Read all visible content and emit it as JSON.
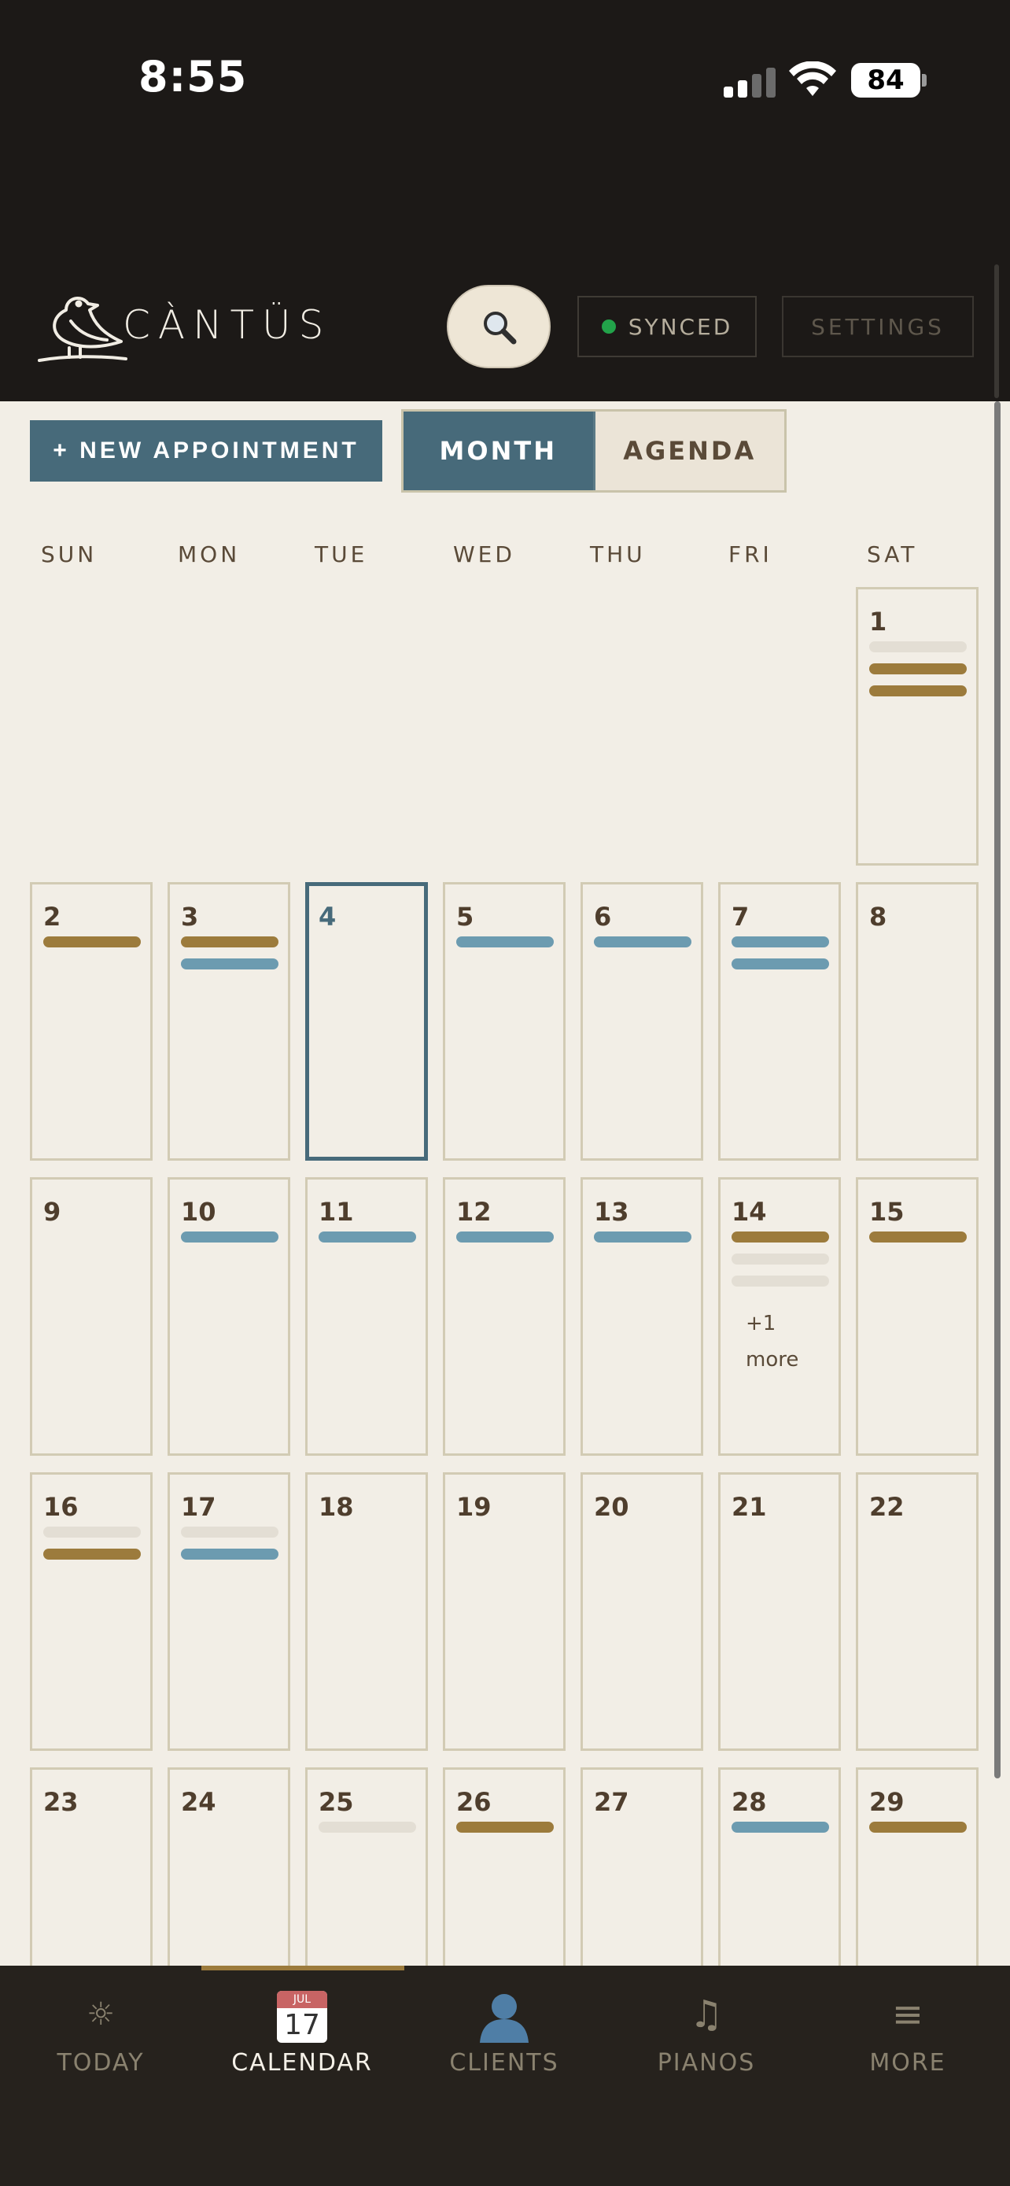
{
  "status_bar": {
    "time": "8:55",
    "battery": "84",
    "icons": [
      "cellular-signal-icon",
      "wifi-icon",
      "battery-icon"
    ]
  },
  "header": {
    "brand": "CÀNTÜS",
    "logo_icon": "bird-logo-icon",
    "search_icon": "magnifier-icon",
    "sync_label": "SYNCED",
    "sync_color": "#22a34a",
    "settings_label": "SETTINGS"
  },
  "toolbar": {
    "new_appointment_label": "+ NEW APPOINTMENT",
    "view_month_label": "MONTH",
    "view_agenda_label": "AGENDA",
    "active_view": "MONTH"
  },
  "calendar": {
    "weekdays": [
      "SUN",
      "MON",
      "TUE",
      "WED",
      "THU",
      "FRI",
      "SAT"
    ],
    "today": "4",
    "more_label": "+1 more",
    "colors": {
      "gold": "#9c7b3c",
      "blue": "#6c9bb0",
      "gray": "#e3ded4",
      "accent": "#476a7a"
    },
    "weeks": [
      [
        null,
        null,
        null,
        null,
        null,
        null,
        {
          "day": "1",
          "events": [
            "gray",
            "gold",
            "gold"
          ]
        }
      ],
      [
        {
          "day": "2",
          "events": [
            "gold"
          ]
        },
        {
          "day": "3",
          "events": [
            "gold",
            "blue"
          ]
        },
        {
          "day": "4",
          "events": []
        },
        {
          "day": "5",
          "events": [
            "blue"
          ]
        },
        {
          "day": "6",
          "events": [
            "blue"
          ]
        },
        {
          "day": "7",
          "events": [
            "blue",
            "blue"
          ]
        },
        {
          "day": "8",
          "events": []
        }
      ],
      [
        {
          "day": "9",
          "events": []
        },
        {
          "day": "10",
          "events": [
            "blue"
          ]
        },
        {
          "day": "11",
          "events": [
            "blue"
          ]
        },
        {
          "day": "12",
          "events": [
            "blue"
          ]
        },
        {
          "day": "13",
          "events": [
            "blue"
          ]
        },
        {
          "day": "14",
          "events": [
            "gold",
            "gray",
            "gray"
          ],
          "more": "+1 more"
        },
        {
          "day": "15",
          "events": [
            "gold"
          ]
        }
      ],
      [
        {
          "day": "16",
          "events": [
            "gray",
            "gold"
          ]
        },
        {
          "day": "17",
          "events": [
            "gray",
            "blue"
          ]
        },
        {
          "day": "18",
          "events": []
        },
        {
          "day": "19",
          "events": []
        },
        {
          "day": "20",
          "events": []
        },
        {
          "day": "21",
          "events": []
        },
        {
          "day": "22",
          "events": []
        }
      ],
      [
        {
          "day": "23",
          "events": []
        },
        {
          "day": "24",
          "events": []
        },
        {
          "day": "25",
          "events": [
            "gray"
          ]
        },
        {
          "day": "26",
          "events": [
            "gold"
          ]
        },
        {
          "day": "27",
          "events": []
        },
        {
          "day": "28",
          "events": [
            "blue"
          ]
        },
        {
          "day": "29",
          "events": [
            "gold"
          ]
        }
      ]
    ]
  },
  "tab_bar": {
    "active": "CALENDAR",
    "tabs": [
      {
        "label": "TODAY",
        "icon": "sun-icon"
      },
      {
        "label": "CALENDAR",
        "icon": "calendar-icon",
        "icon_month": "JUL",
        "icon_day": "17"
      },
      {
        "label": "CLIENTS",
        "icon": "person-icon"
      },
      {
        "label": "PIANOS",
        "icon": "music-note-icon"
      },
      {
        "label": "MORE",
        "icon": "hamburger-menu-icon"
      }
    ]
  }
}
